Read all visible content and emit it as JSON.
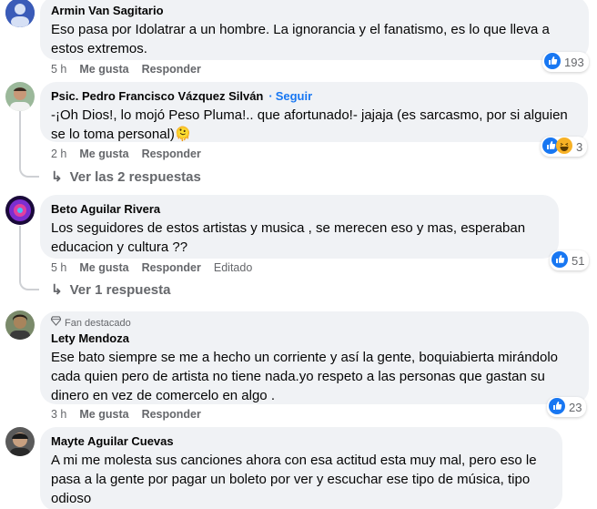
{
  "comments": [
    {
      "author": "Armin Van Sagitario",
      "text": "Eso pasa por Idolatrar a un hombre. La ignorancia y el fanatismo, es lo que lleva a estos extremos.",
      "time": "5 h",
      "like": "Me gusta",
      "reply": "Responder",
      "reaction_count": "193"
    },
    {
      "author": "Psic. Pedro Francisco Vázquez Silván",
      "follow": "Seguir",
      "text": "-¡Oh Dios!, lo mojó Peso Pluma!.. que afortunado!- jajaja (es sarcasmo, por si alguien se lo toma personal)🫠",
      "time": "2 h",
      "like": "Me gusta",
      "reply": "Responder",
      "reaction_count": "3",
      "replies": "Ver las 2 respuestas"
    },
    {
      "author": "Beto Aguilar Rivera",
      "text": "Los seguidores de estos artistas y musica , se merecen eso y mas, esperaban educacion y cultura ??",
      "time": "5 h",
      "like": "Me gusta",
      "reply": "Responder",
      "edited": "Editado",
      "reaction_count": "51",
      "replies": "Ver 1 respuesta"
    },
    {
      "badge": "Fan destacado",
      "author": "Lety Mendoza",
      "text": "Ese bato siempre se me a hecho un corriente y así la gente, boquiabierta mirándolo cada quien pero de artista no tiene nada.yo respeto a las personas que gastan su dinero en vez de comercelo en algo .",
      "time": "3 h",
      "like": "Me gusta",
      "reply": "Responder",
      "reaction_count": "23"
    },
    {
      "author": "Mayte Aguilar Cuevas",
      "text": "A mi me molesta sus canciones ahora con esa actitud esta muy mal, pero eso le pasa a la gente por pagar un boleto por ver y escuchar ese tipo de música, tipo odioso"
    }
  ],
  "colors": {
    "like_blue": "#1877f2",
    "haha_yellow": "#f7b125",
    "bubble": "#f0f2f5",
    "meta": "#65676b"
  }
}
